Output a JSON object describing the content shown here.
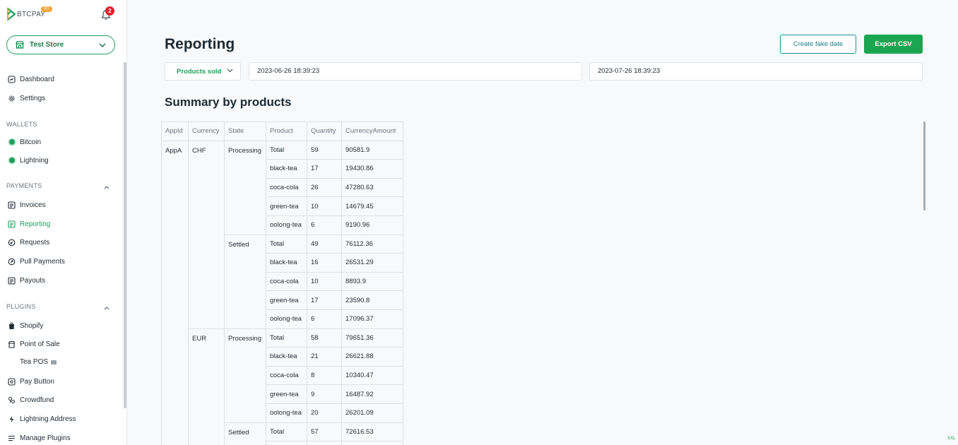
{
  "brand": {
    "name": "BTCPAY",
    "badge": "RT"
  },
  "notifications": {
    "count": "2"
  },
  "store": {
    "name": "Test Store"
  },
  "nav": {
    "dashboard": "Dashboard",
    "settings": "Settings",
    "wallets_header": "WALLETS",
    "bitcoin": "Bitcoin",
    "lightning": "Lightning",
    "payments_header": "PAYMENTS",
    "invoices": "Invoices",
    "reporting": "Reporting",
    "requests": "Requests",
    "pull_payments": "Pull Payments",
    "payouts": "Payouts",
    "plugins_header": "PLUGINS",
    "shopify": "Shopify",
    "point_of_sale": "Point of Sale",
    "tea_pos": "Tea POS",
    "pay_button": "Pay Button",
    "crowdfund": "Crowdfund",
    "lightning_address": "Lightning Address",
    "manage_plugins": "Manage Plugins"
  },
  "page": {
    "title": "Reporting",
    "create_fake_label": "Create fake date",
    "export_label": "Export CSV",
    "view_selected": "Products sold",
    "date_from": "2023-06-26 18:39:23",
    "date_to": "2023-07-26 18:39:23",
    "summary_title": "Summary by products",
    "screen_size": "XXL"
  },
  "table": {
    "headers": [
      "AppId",
      "Currency",
      "State",
      "Product",
      "Quantity",
      "CurrencyAmount"
    ],
    "appid": "AppA",
    "currency_chf": "CHF",
    "currency_eur": "EUR",
    "state_processing": "Processing",
    "state_settled": "Settled",
    "rows": [
      [
        "Total",
        "59",
        "90581.9"
      ],
      [
        "black-tea",
        "17",
        "19430.86"
      ],
      [
        "coca-cola",
        "26",
        "47280.63"
      ],
      [
        "green-tea",
        "10",
        "14679.45"
      ],
      [
        "oolong-tea",
        "6",
        "9190.96"
      ],
      [
        "Total",
        "49",
        "76112.36"
      ],
      [
        "black-tea",
        "16",
        "26531.29"
      ],
      [
        "coca-cola",
        "10",
        "8893.9"
      ],
      [
        "green-tea",
        "17",
        "23590.8"
      ],
      [
        "oolong-tea",
        "6",
        "17096.37"
      ],
      [
        "Total",
        "58",
        "79651.36"
      ],
      [
        "black-tea",
        "21",
        "26621.88"
      ],
      [
        "coca-cola",
        "8",
        "10340.47"
      ],
      [
        "green-tea",
        "9",
        "16487.92"
      ],
      [
        "oolong-tea",
        "20",
        "26201.09"
      ],
      [
        "Total",
        "57",
        "72616.53"
      ]
    ]
  }
}
